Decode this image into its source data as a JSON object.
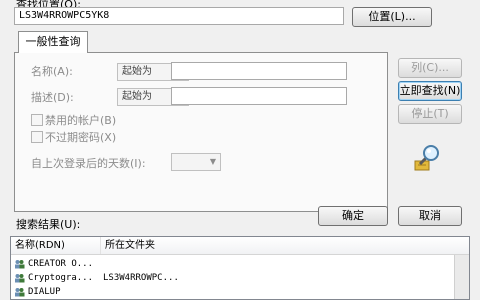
{
  "location": {
    "label": "查找位置(O):",
    "value": "LS3W4RROWPC5YK8",
    "button_label": "位置(L)..."
  },
  "query_tab": {
    "label": "一般性查询",
    "name_label": "名称(A):",
    "name_mode": "起始为",
    "desc_label": "描述(D):",
    "desc_mode": "起始为",
    "disabled_accounts_label": "禁用的帐户(B)",
    "non_expiring_pw_label": "不过期密码(X)",
    "days_since_logon_label": "自上次登录后的天数(I):"
  },
  "side_buttons": {
    "columns": "列(C)...",
    "find_now": "立即查找(N)",
    "stop": "停止(T)"
  },
  "bottom_buttons": {
    "ok": "确定",
    "cancel": "取消"
  },
  "results": {
    "label": "搜索结果(U):",
    "columns": [
      "名称(RDN)",
      "所在文件夹"
    ],
    "rows": [
      {
        "name": "CREATOR O...",
        "folder": ""
      },
      {
        "name": "Cryptogra...",
        "folder": "LS3W4RROWPC..."
      },
      {
        "name": "DIALUP",
        "folder": ""
      }
    ]
  },
  "colors": {
    "dialog_bg": "#f0f0f0",
    "default_button_border": "#3c7fb1"
  },
  "icons": {
    "search": "magnifier-icon",
    "user": "users-group-icon"
  }
}
